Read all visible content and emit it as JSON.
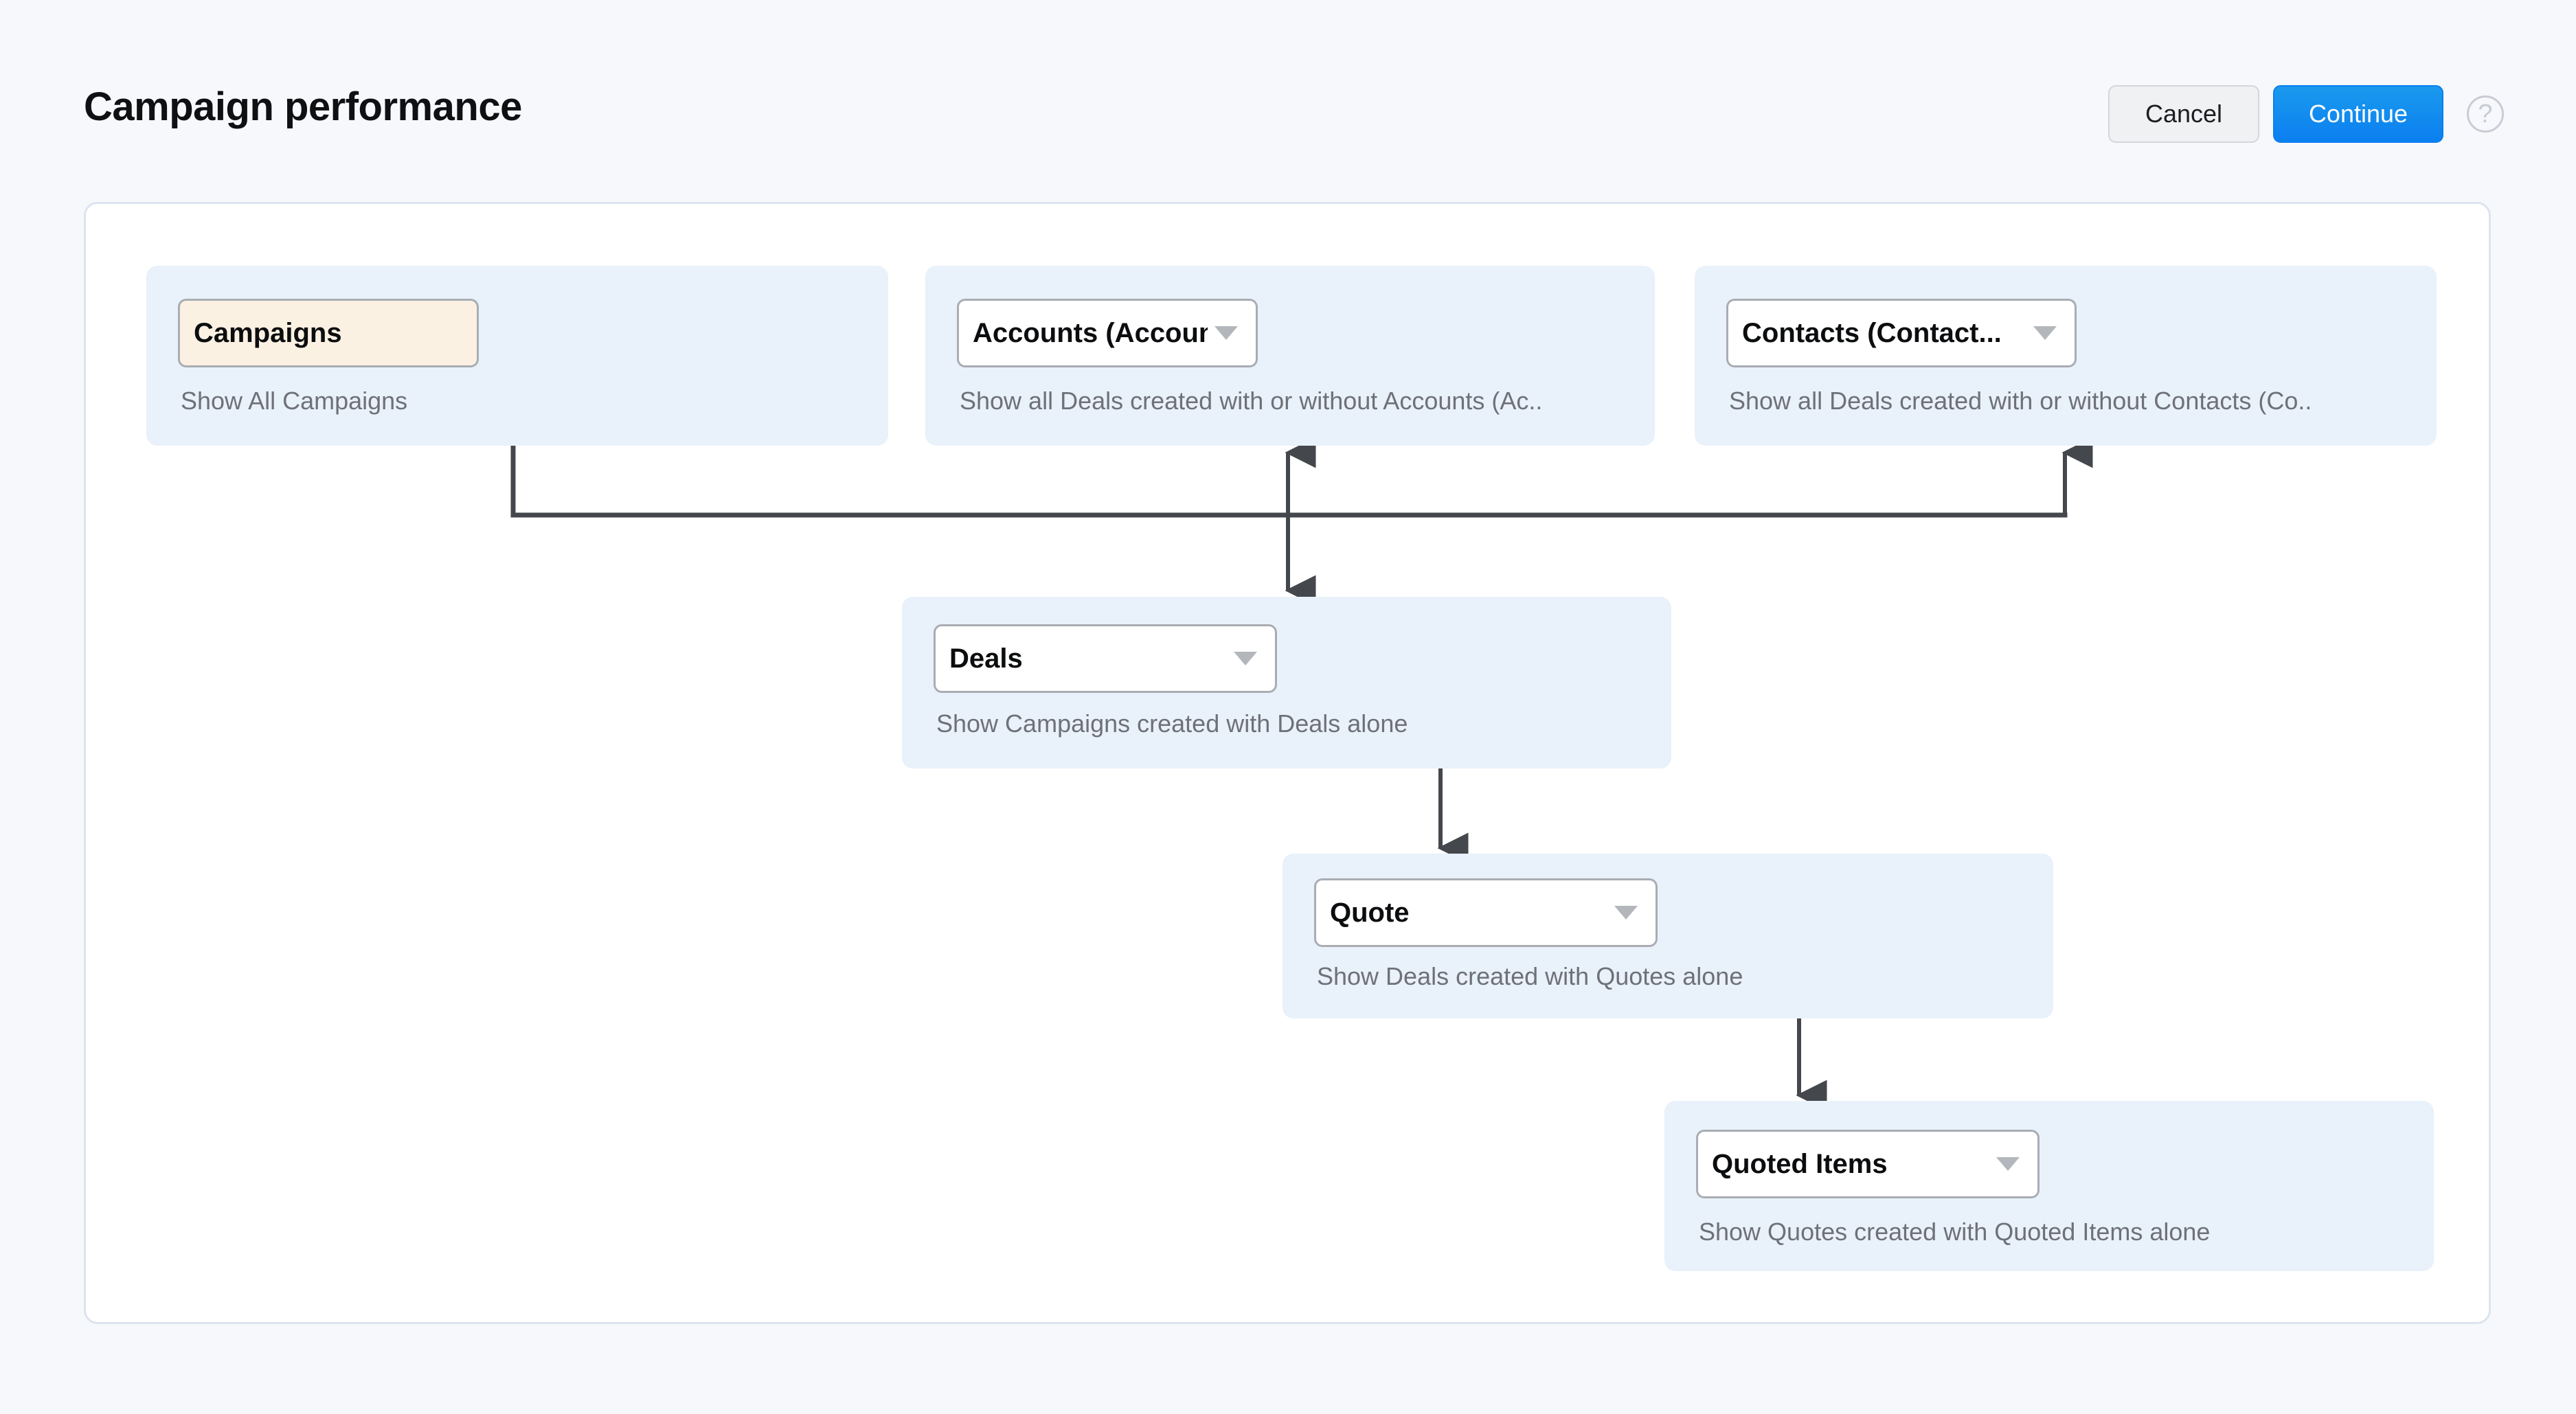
{
  "header": {
    "title": "Campaign performance",
    "cancel_label": "Cancel",
    "continue_label": "Continue",
    "help_glyph": "?",
    "help_icon_name": "help-circle-icon"
  },
  "colors": {
    "page_background": "#f7f8fb",
    "panel_background": "#ffffff",
    "panel_border": "#dce4ef",
    "node_background": "#e9f1fa",
    "chip_background": "#fbf1e3",
    "control_border": "#a9adb3",
    "primary_button": "#0b7ff0",
    "connector": "#44474c",
    "description_text": "#6e7178",
    "title_text": "#0e1012"
  },
  "nodes": [
    {
      "id": "campaigns",
      "label": "Campaigns",
      "description": "Show All Campaigns",
      "has_caret": false,
      "selected": true
    },
    {
      "id": "accounts",
      "label": "Accounts (Account...",
      "description": "Show all Deals created with or without Accounts (Ac..",
      "has_caret": true,
      "selected": false
    },
    {
      "id": "contacts",
      "label": "Contacts (Contact...",
      "description": "Show all Deals created with or without Contacts (Co..",
      "has_caret": true,
      "selected": false
    },
    {
      "id": "deals",
      "label": "Deals",
      "description": "Show Campaigns created with Deals alone",
      "has_caret": true,
      "selected": false
    },
    {
      "id": "quote",
      "label": "Quote",
      "description": "Show Deals created with Quotes alone",
      "has_caret": true,
      "selected": false
    },
    {
      "id": "quoteditems",
      "label": "Quoted Items",
      "description": "Show Quotes created with Quoted Items alone",
      "has_caret": true,
      "selected": false
    }
  ],
  "connections": [
    {
      "from": "campaigns",
      "to": "accounts",
      "style": "elbow-bus-up"
    },
    {
      "from": "campaigns",
      "to": "contacts",
      "style": "elbow-bus-up"
    },
    {
      "from": "campaigns",
      "to": "deals",
      "style": "elbow-bus-down"
    },
    {
      "from": "deals",
      "to": "quote",
      "style": "straight-down"
    },
    {
      "from": "quote",
      "to": "quoteditems",
      "style": "straight-down"
    }
  ]
}
